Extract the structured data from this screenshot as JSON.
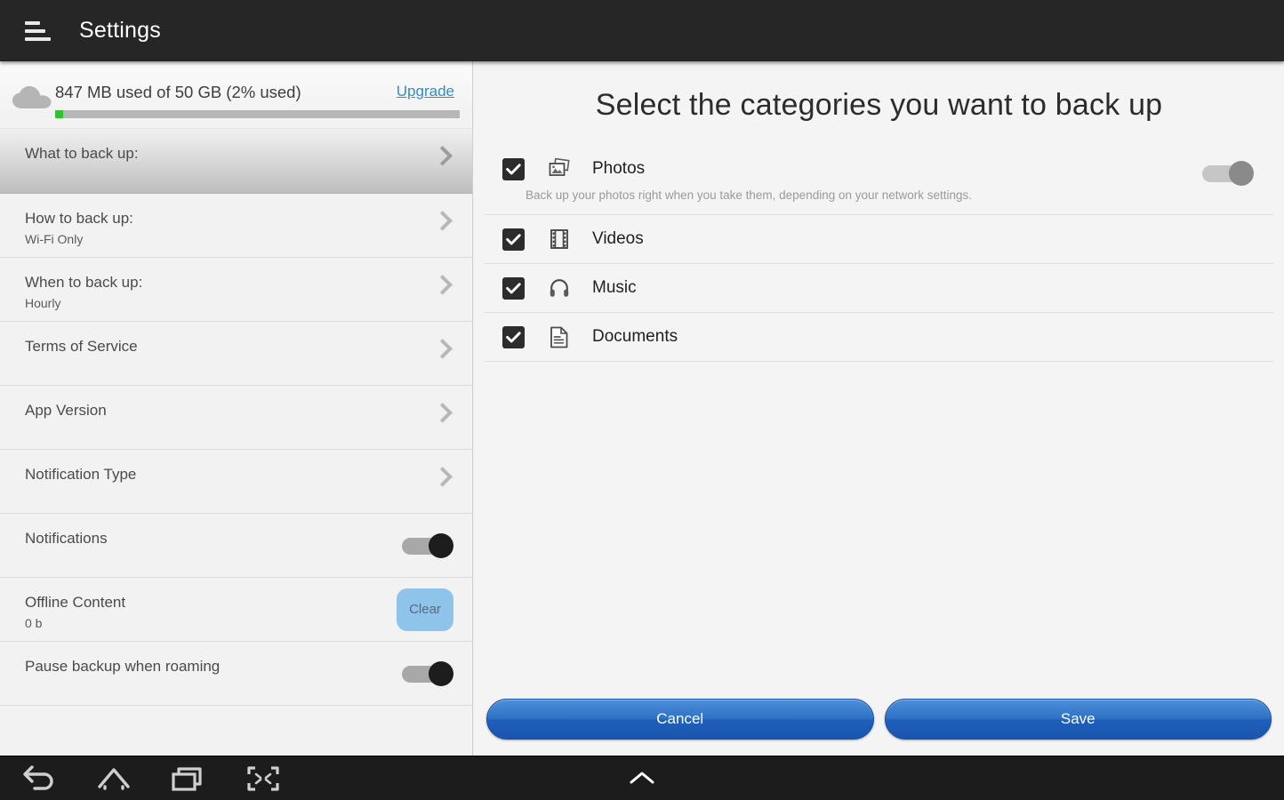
{
  "titlebar": {
    "title": "Settings",
    "menu_icon": "hamburger-icon"
  },
  "sidebar": {
    "storage": {
      "icon": "cloud-icon",
      "text": "847 MB used of 50 GB (2% used)",
      "upgrade_label": "Upgrade",
      "percent_used": 2,
      "bar_fill_color": "#34c232",
      "bar_track_color": "#b6b6b6"
    },
    "items": [
      {
        "title": "What to back up:",
        "sub": "",
        "accessory": "chevron",
        "selected": true
      },
      {
        "title": "How to back up:",
        "sub": "Wi-Fi Only",
        "accessory": "chevron",
        "selected": false
      },
      {
        "title": "When to back up:",
        "sub": "Hourly",
        "accessory": "chevron",
        "selected": false
      },
      {
        "title": "Terms of Service",
        "sub": "",
        "accessory": "chevron",
        "selected": false
      },
      {
        "title": "App Version",
        "sub": "",
        "accessory": "chevron",
        "selected": false
      },
      {
        "title": "Notification Type",
        "sub": "",
        "accessory": "chevron",
        "selected": false
      },
      {
        "title": "Notifications",
        "sub": "",
        "accessory": "toggle",
        "toggle_on": true,
        "selected": false
      },
      {
        "title": "Offline Content",
        "sub": "0 b",
        "accessory": "button",
        "button_label": "Clear",
        "selected": false
      },
      {
        "title": "Pause backup when roaming",
        "sub": "",
        "accessory": "toggle",
        "toggle_on": true,
        "selected": false
      }
    ]
  },
  "panel": {
    "title": "Select the categories you want to back up",
    "categories": [
      {
        "label": "Photos",
        "icon": "photos-icon",
        "checked": true,
        "description": "Back up your photos right when you take them, depending on your network settings.",
        "has_toggle": true,
        "toggle_on": false
      },
      {
        "label": "Videos",
        "icon": "film-icon",
        "checked": true,
        "description": "",
        "has_toggle": false
      },
      {
        "label": "Music",
        "icon": "headphones-icon",
        "checked": true,
        "description": "",
        "has_toggle": false
      },
      {
        "label": "Documents",
        "icon": "document-icon",
        "checked": true,
        "description": "",
        "has_toggle": false
      }
    ],
    "cancel_label": "Cancel",
    "save_label": "Save",
    "button_color": "#2f72c6"
  },
  "navbar": {
    "back": "back-icon",
    "home": "home-icon",
    "recents": "recents-icon",
    "shrink": "shrink-screen-icon",
    "chevron": "chevron-up-icon"
  }
}
